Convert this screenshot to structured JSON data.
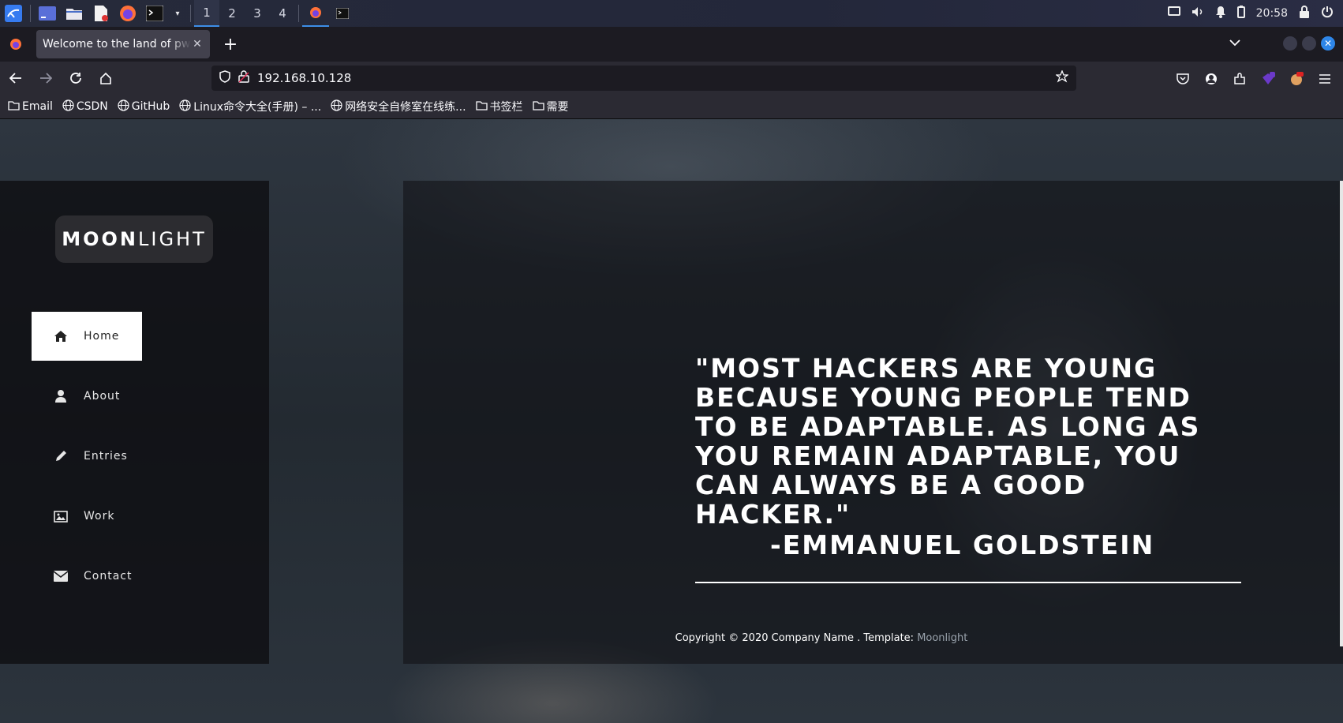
{
  "taskbar": {
    "workspaces": [
      "1",
      "2",
      "3",
      "4"
    ],
    "active_workspace": "1",
    "clock": "20:58"
  },
  "browser": {
    "tab_title": "Welcome to the land of pwnland",
    "url": "192.168.10.128",
    "bookmarks": [
      {
        "label": "Email",
        "icon": "folder-icon"
      },
      {
        "label": "CSDN",
        "icon": "globe-icon"
      },
      {
        "label": "GitHub",
        "icon": "globe-icon"
      },
      {
        "label": "Linux命令大全(手册) – ...",
        "icon": "globe-icon"
      },
      {
        "label": "网络安全自修室在线练...",
        "icon": "globe-icon"
      },
      {
        "label": "书签栏",
        "icon": "folder-icon"
      },
      {
        "label": "需要",
        "icon": "folder-icon"
      }
    ]
  },
  "site": {
    "logo_bold": "MOON",
    "logo_light": "LIGHT",
    "menu": [
      {
        "label": "Home",
        "icon": "home-icon",
        "active": true
      },
      {
        "label": "About",
        "icon": "user-icon",
        "active": false
      },
      {
        "label": "Entries",
        "icon": "pencil-icon",
        "active": false
      },
      {
        "label": "Work",
        "icon": "image-icon",
        "active": false
      },
      {
        "label": "Contact",
        "icon": "envelope-icon",
        "active": false
      }
    ],
    "quote": "\"MOST HACKERS ARE YOUNG BECAUSE YOUNG PEOPLE TEND TO BE ADAPTABLE. AS LONG AS YOU REMAIN ADAPTABLE, YOU CAN ALWAYS BE A GOOD HACKER.\"",
    "quote_author": "-EMMANUEL GOLDSTEIN",
    "footer_text": "Copyright © 2020 Company Name . Template: ",
    "footer_link": "Moonlight"
  },
  "colors": {
    "accent": "#3d8ee8",
    "sidebar_bg": "#0f0f12",
    "active_menu_bg": "#ffffff"
  }
}
